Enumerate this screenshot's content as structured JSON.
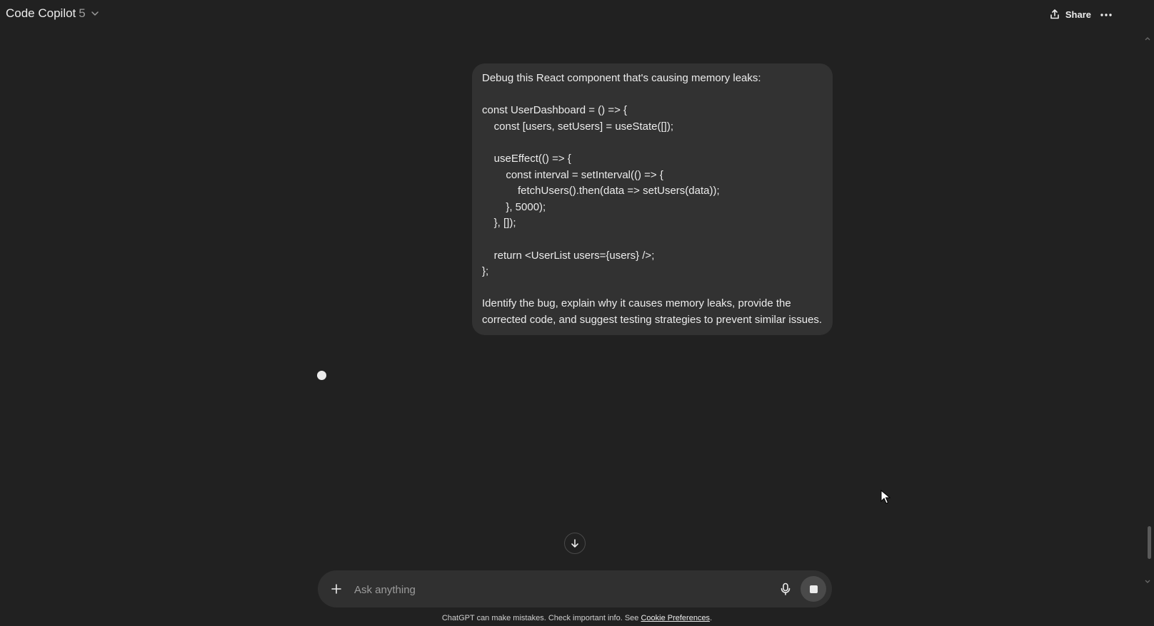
{
  "header": {
    "model_name": "Code Copilot",
    "model_version": "5",
    "share_label": "Share"
  },
  "message": {
    "lines": [
      "Debug this React component that's causing memory leaks:",
      "",
      "const UserDashboard = () => {",
      "    const [users, setUsers] = useState([]);",
      "",
      "    useEffect(() => {",
      "        const interval = setInterval(() => {",
      "            fetchUsers().then(data => setUsers(data));",
      "        }, 5000);",
      "    }, []);",
      "",
      "    return <UserList users={users} />;",
      "};",
      "",
      "Identify the bug, explain why it causes memory leaks, provide the",
      "corrected code, and suggest testing strategies to prevent similar issues."
    ]
  },
  "composer": {
    "placeholder": "Ask anything"
  },
  "footer": {
    "disclaimer_text": "ChatGPT can make mistakes. Check important info. See ",
    "link_text": "Cookie Preferences",
    "trailing": "."
  },
  "icons": {
    "chevron": "chevron-down-icon",
    "share": "share-icon",
    "more": "more-icon",
    "scroll_down": "arrow-down-icon",
    "plus": "plus-icon",
    "mic": "microphone-icon",
    "stop": "stop-icon"
  },
  "colors": {
    "background": "#212121",
    "bubble": "#323232",
    "composer": "#303030",
    "text": "#ececec"
  }
}
